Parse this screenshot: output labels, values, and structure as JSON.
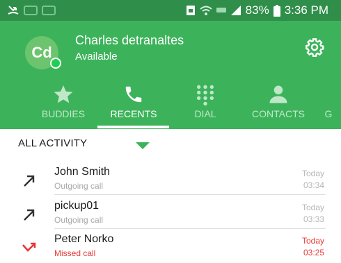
{
  "status_bar": {
    "battery": "83%",
    "time": "3:36 PM",
    "icons": [
      "missed-call-icon",
      "notification-icon",
      "sim-icon",
      "wifi-icon",
      "lte-icon",
      "signal-icon",
      "battery-icon"
    ]
  },
  "profile": {
    "initials": "Cd",
    "name": "Charles detranaltes",
    "status": "Available",
    "presence_color": "#1fcf55"
  },
  "tabs": [
    {
      "label": "BUDDIES",
      "icon": "star-icon",
      "active": false
    },
    {
      "label": "RECENTS",
      "icon": "phone-icon",
      "active": true
    },
    {
      "label": "DIAL",
      "icon": "dialpad-icon",
      "active": false
    },
    {
      "label": "CONTACTS",
      "icon": "person-icon",
      "active": false
    },
    {
      "label": "G",
      "icon": "",
      "active": false
    }
  ],
  "filter": {
    "label": "ALL ACTIVITY"
  },
  "calls": [
    {
      "name": "John Smith",
      "type": "Outgoing call",
      "date": "Today",
      "time": "03:34",
      "icon": "outgoing-call-icon"
    },
    {
      "name": "pickup01",
      "type": "Outgoing call",
      "date": "Today",
      "time": "03:33",
      "icon": "outgoing-call-icon"
    },
    {
      "name": "Peter Norko",
      "type": "Missed call",
      "date": "Today",
      "time": "03:25",
      "icon": "missed-call-icon"
    }
  ],
  "colors": {
    "header": "#3cb35a",
    "status_bar": "#2f8f4a",
    "missed": "#e53935"
  }
}
